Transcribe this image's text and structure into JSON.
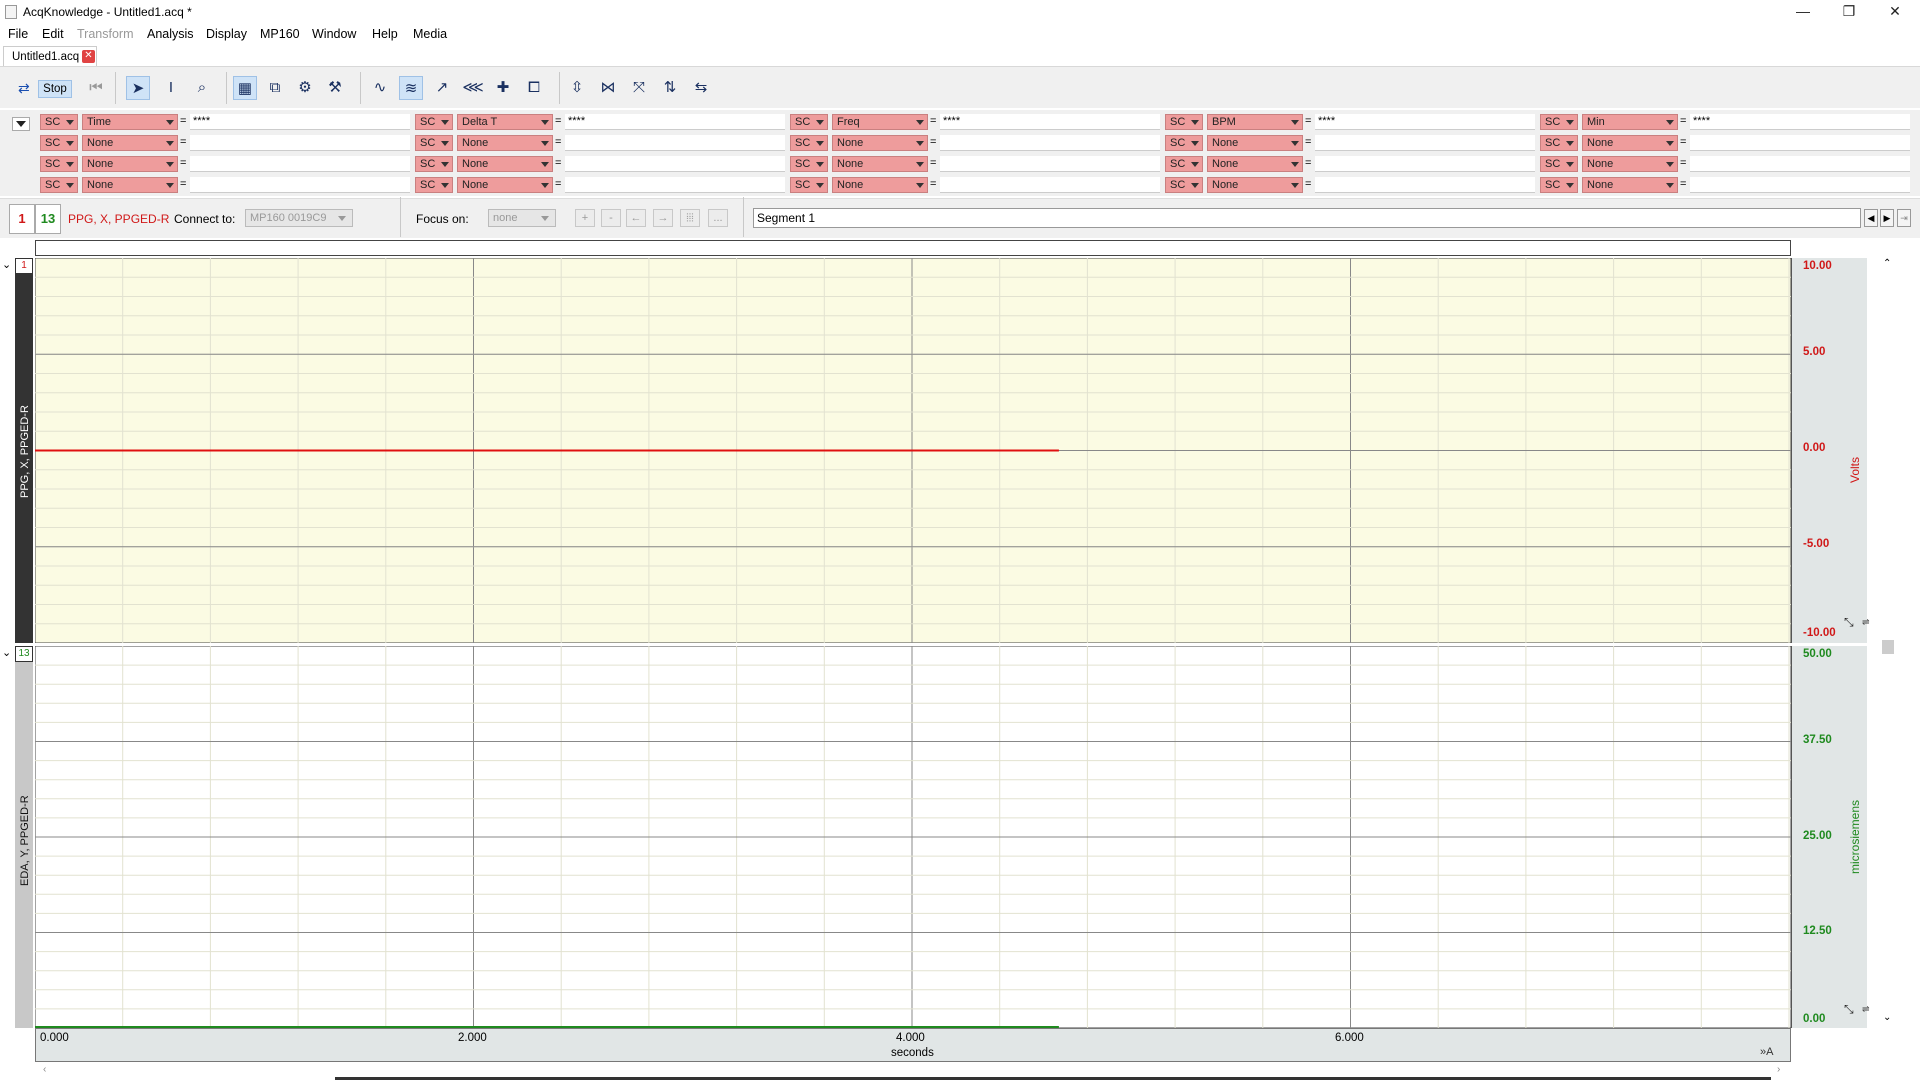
{
  "window": {
    "title": "AcqKnowledge - Untitled1.acq *",
    "minimize": "—",
    "restore": "❐",
    "close": "✕"
  },
  "menu": [
    "File",
    "Edit",
    "Transform",
    "Analysis",
    "Display",
    "MP160",
    "Window",
    "Help",
    "Media"
  ],
  "doc_tab": {
    "label": "Untitled1.acq",
    "close": "✕"
  },
  "toolbar": {
    "stop_label": "Stop",
    "icons": [
      "stop-icon",
      "rewind-icon",
      "arrow-tool-icon",
      "ibeam-tool-icon",
      "zoom-tool-icon",
      "grid-icon",
      "overlap-icon",
      "settings-icon",
      "calibrate-icon",
      "wave-icon",
      "stacked-icon",
      "graph-icon",
      "multi-graph-icon",
      "cursor-move-icon",
      "split-icon",
      "autoscale-icon",
      "autoscale-wave-icon",
      "fit-icon",
      "compress-icon",
      "refresh-icon"
    ]
  },
  "measurements": {
    "rows": [
      [
        {
          "src": "SC",
          "fn": "Time",
          "val": "****"
        },
        {
          "src": "SC",
          "fn": "Delta T",
          "val": "****"
        },
        {
          "src": "SC",
          "fn": "Freq",
          "val": "****"
        },
        {
          "src": "SC",
          "fn": "BPM",
          "val": "****"
        },
        {
          "src": "SC",
          "fn": "Min",
          "val": "****"
        }
      ],
      [
        {
          "src": "SC",
          "fn": "None",
          "val": ""
        },
        {
          "src": "SC",
          "fn": "None",
          "val": ""
        },
        {
          "src": "SC",
          "fn": "None",
          "val": ""
        },
        {
          "src": "SC",
          "fn": "None",
          "val": ""
        },
        {
          "src": "SC",
          "fn": "None",
          "val": ""
        }
      ],
      [
        {
          "src": "SC",
          "fn": "None",
          "val": ""
        },
        {
          "src": "SC",
          "fn": "None",
          "val": ""
        },
        {
          "src": "SC",
          "fn": "None",
          "val": ""
        },
        {
          "src": "SC",
          "fn": "None",
          "val": ""
        },
        {
          "src": "SC",
          "fn": "None",
          "val": ""
        }
      ],
      [
        {
          "src": "SC",
          "fn": "None",
          "val": ""
        },
        {
          "src": "SC",
          "fn": "None",
          "val": ""
        },
        {
          "src": "SC",
          "fn": "None",
          "val": ""
        },
        {
          "src": "SC",
          "fn": "None",
          "val": ""
        },
        {
          "src": "SC",
          "fn": "None",
          "val": ""
        }
      ]
    ],
    "eq": "="
  },
  "channelbar": {
    "ch1": "1",
    "ch13": "13",
    "selected_channel_label": "PPG, X, PPGED-R",
    "connect_label": "Connect to:",
    "connect_value": "MP160 0019C9",
    "focus_label": "Focus on:",
    "focus_value": "none",
    "focus_buttons": [
      "+",
      "-",
      "←",
      "→",
      "⦙⦙⦙",
      "..."
    ],
    "segment": "Segment 1",
    "colors": {
      "ch1": "#d01818",
      "ch13": "#1f8a1f"
    }
  },
  "graph": {
    "x_unit": "seconds",
    "x_ticks": [
      "0.000",
      "2.000",
      "4.000",
      "6.000"
    ],
    "channels": [
      {
        "num": "1",
        "label": "PPG, X, PPGED-R",
        "unit": "Volts",
        "ticks": [
          "10.00",
          "5.00",
          "0.00",
          "-5.00",
          "-10.00"
        ],
        "color": "#e01010",
        "background": "#fbfbe3"
      },
      {
        "num": "13",
        "label": "EDA, Y, PPGED-R",
        "unit": "microsiemens",
        "ticks": [
          "50.00",
          "37.50",
          "25.00",
          "12.50",
          "0.00"
        ],
        "color": "#1f8a1f",
        "background": "#ffffff"
      }
    ]
  }
}
